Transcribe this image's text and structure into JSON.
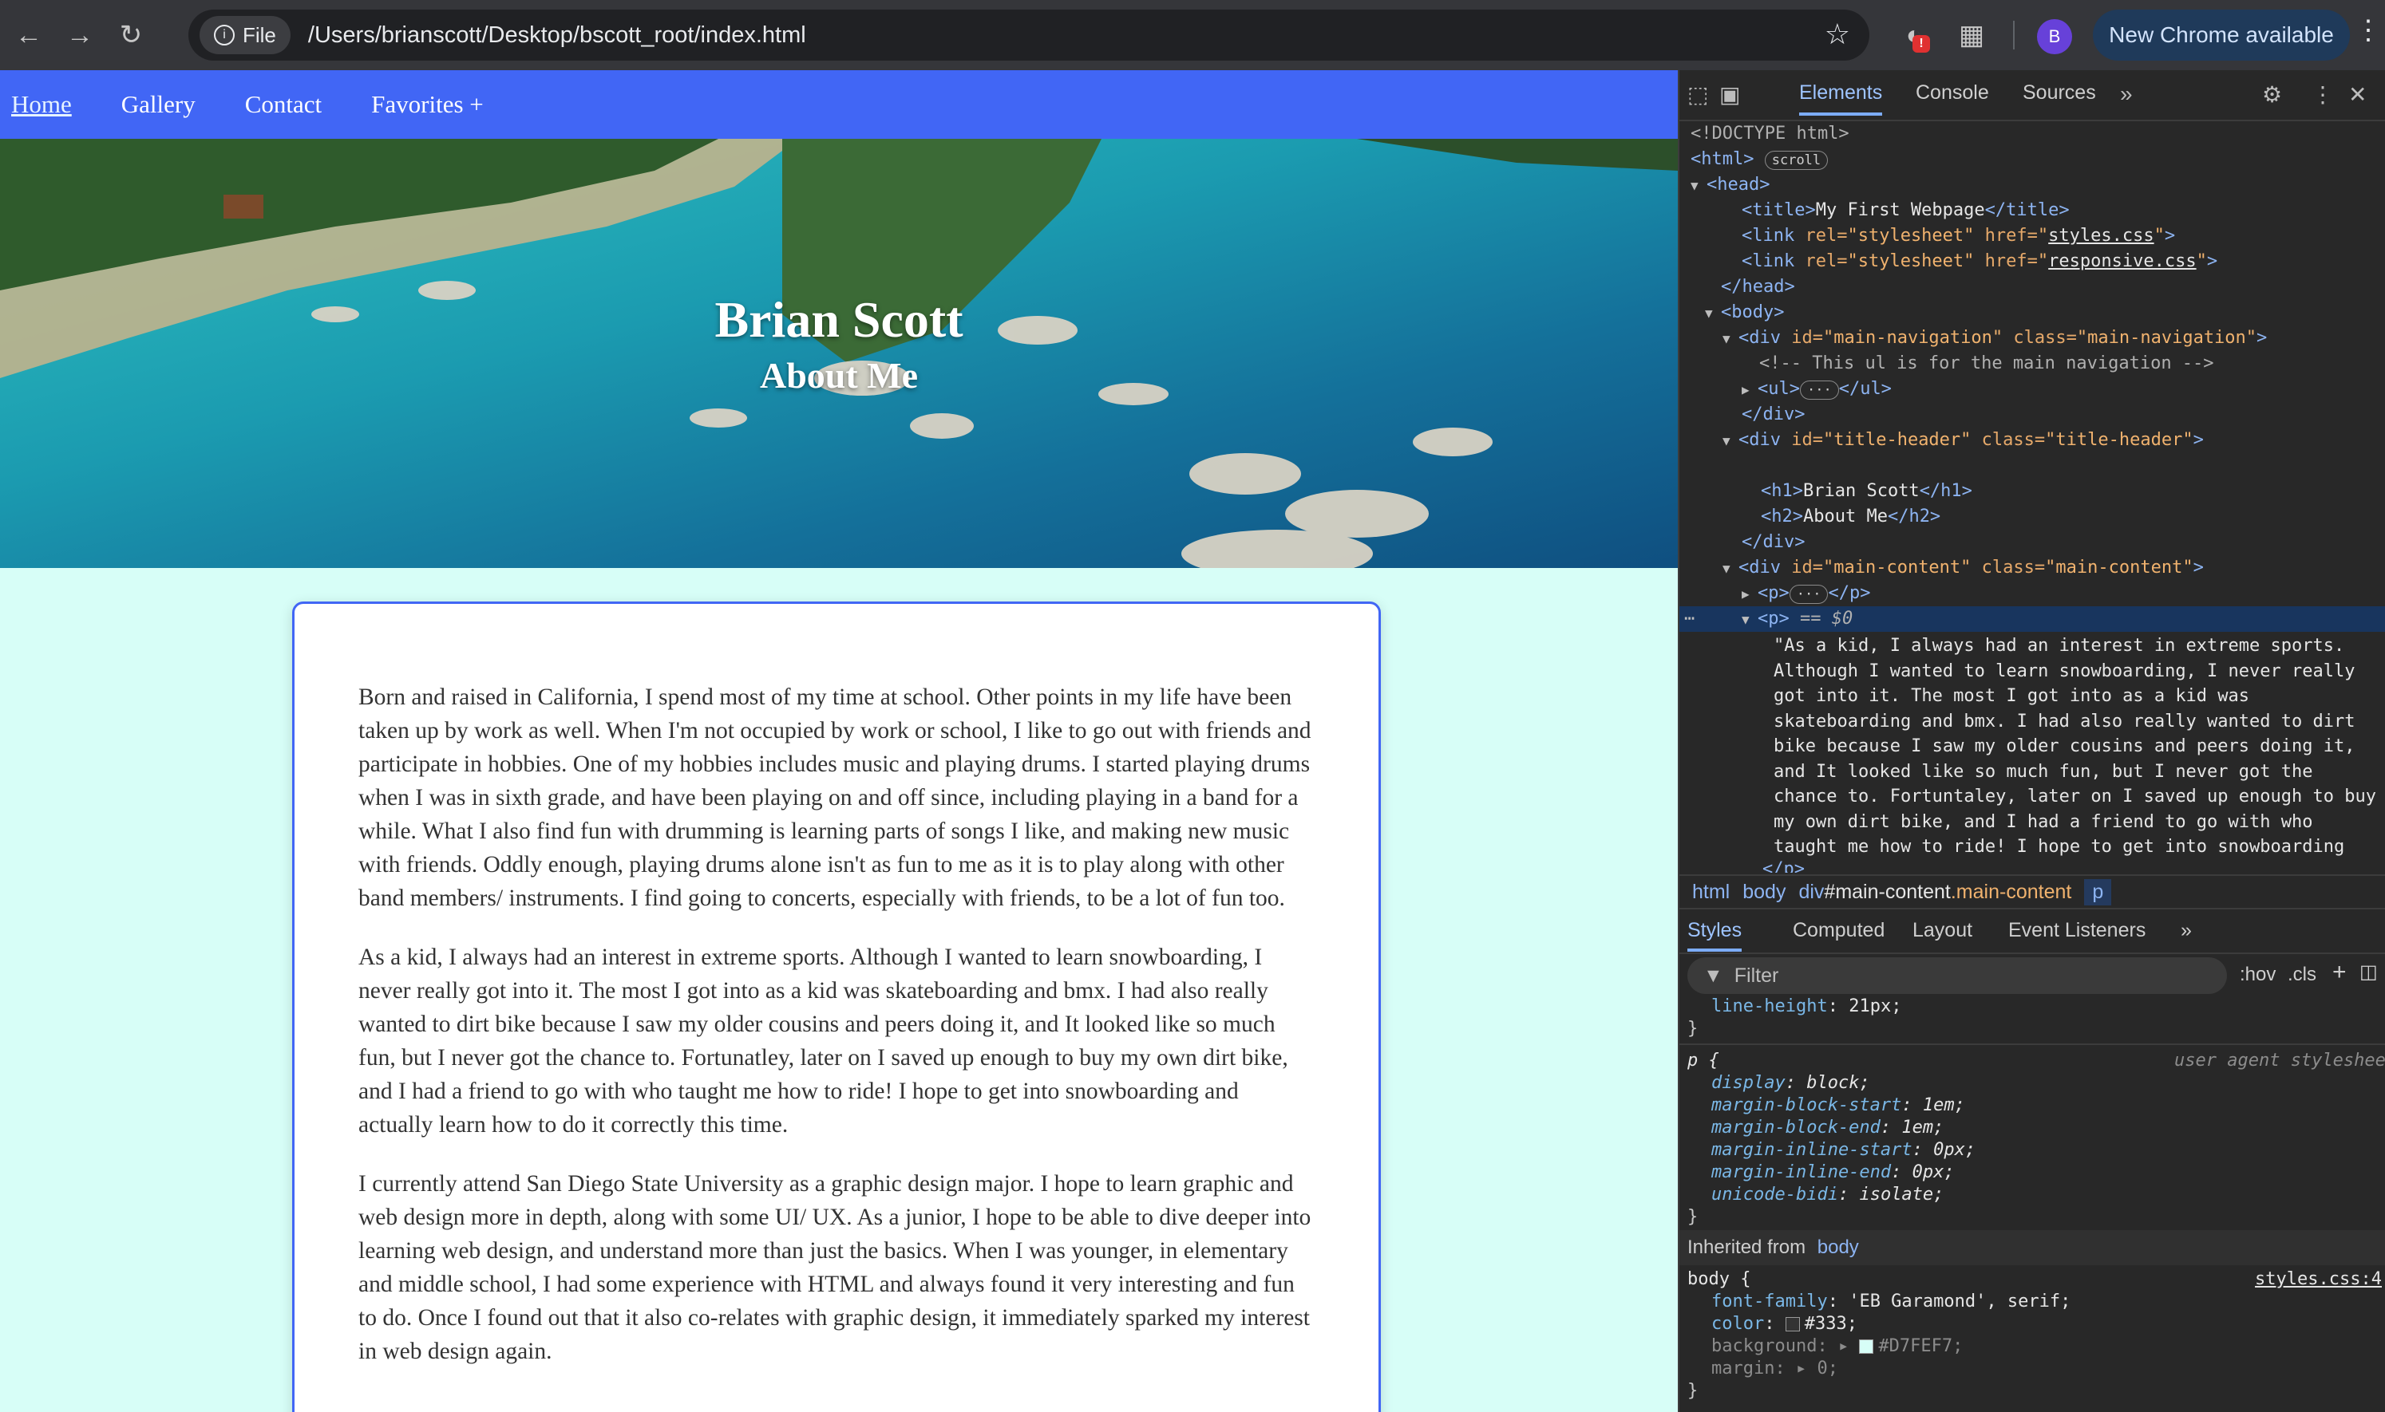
{
  "browser": {
    "file_chip": "File",
    "url": "/Users/brianscott/Desktop/bscott_root/index.html",
    "extension_badge": "!",
    "avatar_letter": "B",
    "update_label": "New Chrome available"
  },
  "page": {
    "nav": [
      "Home",
      "Gallery",
      "Contact",
      "Favorites +"
    ],
    "title": "Brian Scott",
    "subtitle": "About Me",
    "paragraphs": [
      "Born and raised in California, I spend most of my time at school. Other points in my life have been taken up by work as well. When I'm not occupied by work or school, I like to go out with friends and participate in hobbies. One of my hobbies includes music and playing drums. I started playing drums when I was in sixth grade, and have been playing on and off since, including playing in a band for a while. What I also find fun with drumming is learning parts of songs I like, and making new music with friends. Oddly enough, playing drums alone isn't as fun to me as it is to play along with other band members/ instruments. I find going to concerts, especially with friends, to be a lot of fun too.",
      "As a kid, I always had an interest in extreme sports. Although I wanted to learn snowboarding, I never really got into it. The most I got into as a kid was skateboarding and bmx. I had also really wanted to dirt bike because I saw my older cousins and peers doing it, and It looked like so much fun, but I never got the chance to. Fortunatley, later on I saved up enough to buy my own dirt bike, and I had a friend to go with who taught me how to ride! I hope to get into snowboarding and actually learn how to do it correctly this time.",
      "I currently attend San Diego State University as a graphic design major. I hope to learn graphic and web design more in depth, along with some UI/ UX. As a junior, I hope to be able to dive deeper into learning web design, and understand more than just the basics. When I was younger, in elementary and middle school, I had some experience with HTML and always found it very interesting and fun to do. Once I found out that it also co-relates with graphic design, it immediately sparked my interest in web design again."
    ]
  },
  "devtools": {
    "tabs": [
      "Elements",
      "Console",
      "Sources"
    ],
    "dom": {
      "doctype": "<!DOCTYPE html>",
      "html_tag": "<html>",
      "scroll_pill": "scroll",
      "head_open": "<head>",
      "title_open": "<title>",
      "title_text": "My First Webpage",
      "title_close": "</title>",
      "link_open": "<link ",
      "rel_attr": "rel=",
      "rel_val": "\"stylesheet\"",
      "href_attr": " href=",
      "css1": "styles.css",
      "css2": "responsive.css",
      "link_close": ">",
      "head_close": "</head>",
      "body_open": "<body>",
      "div_open": "<div ",
      "id_attr": "id=",
      "class_attr": " class=",
      "nav_id": "\"main-navigation\"",
      "comment": "<!-- This ul is for the main navigation -->",
      "ul": "<ul>",
      "ul_close": "</ul>",
      "div_close": "</div>",
      "header_id": "\"title-header\"",
      "h1_open": "<h1>",
      "h1_text": "Brian Scott",
      "h1_close": "</h1>",
      "h2_open": "<h2>",
      "h2_text": "About Me",
      "h2_close": "</h2>",
      "content_id": "\"main-content\"",
      "p_open": "<p>",
      "p_close": "</p>",
      "ellipsis": "···",
      "selected_marker": "== $0",
      "selected_text": "\"As a kid, I always had an interest in extreme sports. Although I wanted to learn snowboarding, I never really got into it. The most I got into as a kid was skateboarding and bmx. I had also really wanted to dirt bike because I saw my older cousins and peers doing it, and It looked like so much fun, but I never got the chance to. Fortuntaley, later on I saved up enough to buy my own dirt bike, and I had a friend to go with who taught me how to ride! I hope to get into snowboarding and actually learn how to do it correctly this time. \"",
      "cut_line": "</p>"
    },
    "breadcrumb": {
      "html": "html",
      "body": "body",
      "div_prefix": "div",
      "div_id": "#main-content",
      "div_class": ".main-content",
      "p": "p"
    },
    "styles_tabs": [
      "Styles",
      "Computed",
      "Layout",
      "Event Listeners"
    ],
    "filter_placeholder": "Filter",
    "filter_tools": [
      ":hov",
      ".cls"
    ],
    "styles": {
      "line_height_prop": "line-height",
      "line_height_val": "21px",
      "p_selector": "p {",
      "ua_label": "user agent stylesheet",
      "p_rules": [
        {
          "prop": "display",
          "val": "block"
        },
        {
          "prop": "margin-block-start",
          "val": "1em"
        },
        {
          "prop": "margin-block-end",
          "val": "1em"
        },
        {
          "prop": "margin-inline-start",
          "val": "0px"
        },
        {
          "prop": "margin-inline-end",
          "val": "0px"
        },
        {
          "prop": "unicode-bidi",
          "val": "isolate"
        }
      ],
      "inherited_label": "Inherited from",
      "inherited_from": "body",
      "body_selector": "body {",
      "body_source": "styles.css:4",
      "body_font_prop": "font-family",
      "body_font_val": "'EB Garamond', serif",
      "body_color_prop": "color",
      "body_color_val": "#333",
      "body_bg_prop": "background",
      "body_bg_val": "#D7FEF7",
      "body_margin_prop": "margin",
      "body_margin_val": "0",
      "close_brace": "}"
    }
  },
  "colors": {
    "nav_blue": "#4166f5",
    "page_bg": "#d7fef7",
    "text": "#333333",
    "devtools_bg": "#282828",
    "selected_row": "#18355e"
  }
}
